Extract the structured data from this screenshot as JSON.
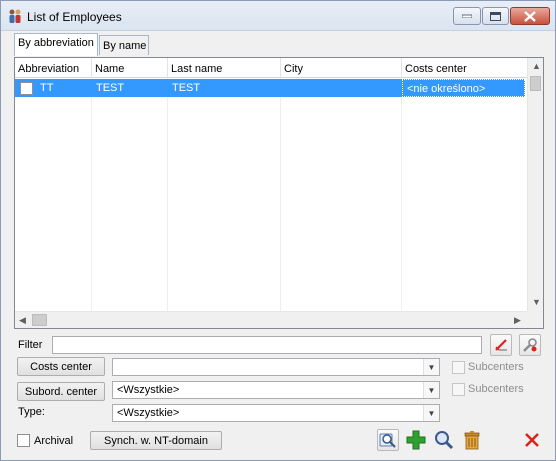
{
  "window": {
    "title": "List of Employees"
  },
  "tabs": [
    {
      "label": "By abbreviation",
      "active": true
    },
    {
      "label": "By name",
      "active": false
    }
  ],
  "grid": {
    "columns": [
      "Abbreviation",
      "Name",
      "Last name",
      "City",
      "Costs center"
    ],
    "rows": [
      {
        "checked": false,
        "abbreviation": "TT",
        "name": "TEST",
        "last_name": "TEST",
        "city": "",
        "costs_center": "<nie określono>",
        "selected": true
      }
    ]
  },
  "filter": {
    "label": "Filter",
    "value": ""
  },
  "costs_center": {
    "button_label": "Costs center",
    "value": "",
    "subcenters_label": "Subcenters"
  },
  "subord_center": {
    "button_label": "Subord. center",
    "value": "<Wszystkie>",
    "subcenters_label": "Subcenters"
  },
  "type": {
    "label": "Type:",
    "value": "<Wszystkie>"
  },
  "archival": {
    "label": "Archival",
    "checked": false
  },
  "synch_button": {
    "label": "Synch. w. NT-domain"
  },
  "colors": {
    "selection": "#3399ff",
    "add_green": "#2ea12e",
    "close_red": "#d9251d"
  }
}
